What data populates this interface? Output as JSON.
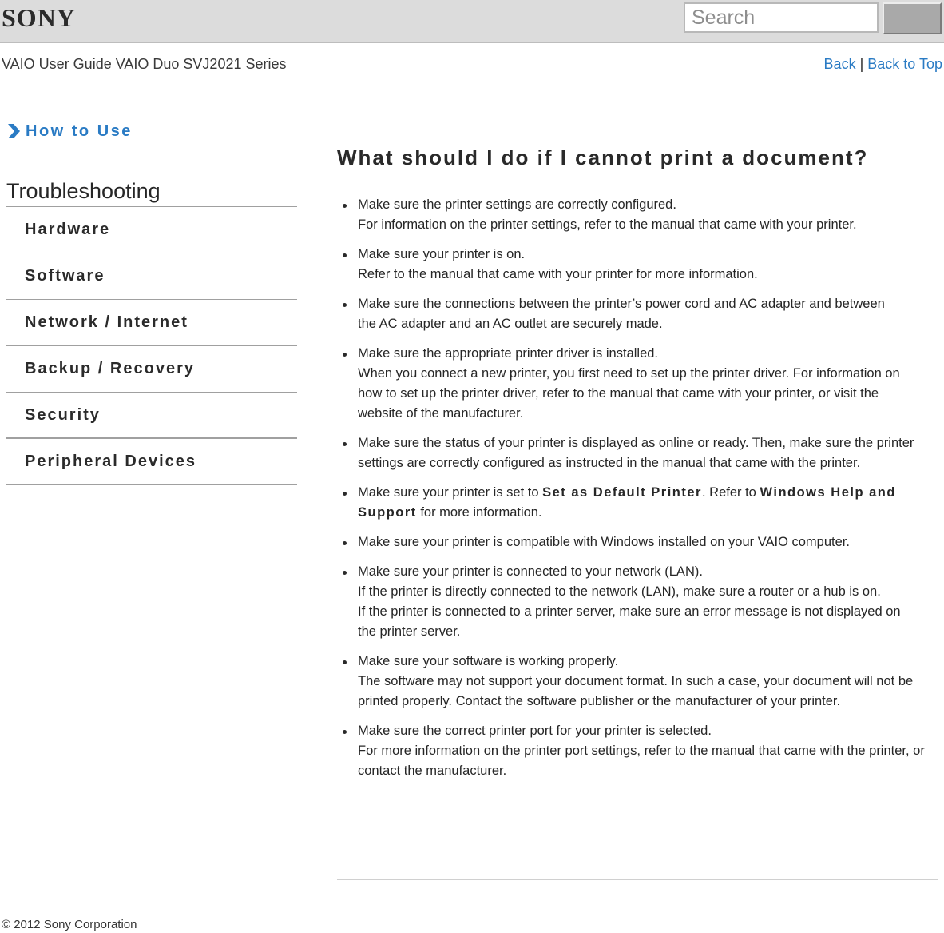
{
  "header": {
    "brand": "SONY",
    "search": {
      "placeholder": "Search",
      "value": ""
    },
    "guide_title": "VAIO User Guide VAIO Duo SVJ2021 Series",
    "links": {
      "back": "Back",
      "separator": "|",
      "back_to_top": "Back to Top"
    }
  },
  "colors": {
    "accent": "#2a7bc4",
    "topbar": "#dcdcdc",
    "text": "#262626"
  },
  "sidebar": {
    "how_to_use": {
      "label": "How to Use",
      "icon": "chevron-right-icon"
    },
    "section_title": "Troubleshooting",
    "items": [
      {
        "label": "Hardware"
      },
      {
        "label": "Software"
      },
      {
        "label": "Network / Internet"
      },
      {
        "label": "Backup / Recovery"
      },
      {
        "label": "Security"
      },
      {
        "label": "Peripheral Devices"
      }
    ]
  },
  "main": {
    "title": "What should I do if I cannot print a document?",
    "tips": [
      {
        "lines": [
          "Make sure the printer settings are correctly configured.",
          "For information on the printer settings, refer to the manual that came with your printer."
        ]
      },
      {
        "lines": [
          "Make sure your printer is on.",
          "Refer to the manual that came with your printer for more information."
        ]
      },
      {
        "lines": [
          "Make sure the connections between the printer’s power cord and AC adapter and between the AC adapter and an AC outlet are securely made."
        ]
      },
      {
        "lines": [
          "Make sure the appropriate printer driver is installed.",
          "When you connect a new printer, you first need to set up the printer driver. For information on how to set up the printer driver, refer to the manual that came with your printer, or visit the website of the manufacturer."
        ]
      },
      {
        "lines": [
          "Make sure the status of your printer is displayed as online or ready. Then, make sure the printer settings are correctly configured as instructed in the manual that came with the printer."
        ]
      },
      {
        "parts": {
          "pre": "Make sure your printer is set to ",
          "term1": "Set as Default Printer",
          "mid": ". Refer to ",
          "term2": "Windows Help and Support",
          "post": " for more information."
        }
      },
      {
        "lines": [
          "Make sure your printer is compatible with Windows installed on your VAIO computer."
        ]
      },
      {
        "lines": [
          "Make sure your printer is connected to your network (LAN).",
          "If the printer is directly connected to the network (LAN), make sure a router or a hub is on.",
          "If the printer is connected to a printer server, make sure an error message is not displayed on the printer server."
        ]
      },
      {
        "lines": [
          "Make sure your software is working properly.",
          "The software may not support your document format. In such a case, your document will not be printed properly. Contact the software publisher or the manufacturer of your printer."
        ]
      },
      {
        "lines": [
          "Make sure the correct printer port for your printer is selected.",
          "For more information on the printer port settings, refer to the manual that came with the printer, or contact the manufacturer."
        ]
      }
    ]
  },
  "footer": {
    "copyright": "© 2012 Sony Corporation"
  }
}
